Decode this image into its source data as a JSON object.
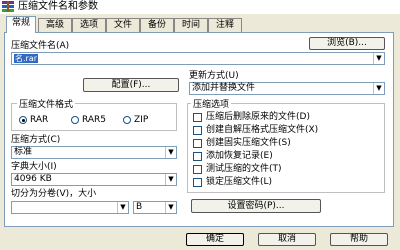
{
  "window": {
    "title": "压缩文件名和参数",
    "icon": "archive-icon"
  },
  "tabs": [
    "常规",
    "高级",
    "选项",
    "文件",
    "备份",
    "时间",
    "注释"
  ],
  "general": {
    "archive_name_label": "压缩文件名(A)",
    "archive_name_value": "名.rar",
    "browse_button": "浏览(B)...",
    "profiles_button": "配置(F)...",
    "update_mode_label": "更新方式(U)",
    "update_mode_value": "添加并替换文件",
    "format_label": "压缩文件格式",
    "formats": [
      "RAR",
      "RAR5",
      "ZIP"
    ],
    "selected_format": "RAR",
    "method_label": "压缩方式(C)",
    "method_value": "标准",
    "dictionary_label": "字典大小(I)",
    "dictionary_value": "4096 KB",
    "split_label": "切分为分卷(V)，大小",
    "split_value": "",
    "split_unit": "B",
    "options_label": "压缩选项",
    "options": [
      "压缩后删除原来的文件(D)",
      "创建自解压格式压缩文件(X)",
      "创建固实压缩文件(S)",
      "添加恢复记录(E)",
      "测试压缩的文件(T)",
      "锁定压缩文件(L)"
    ],
    "password_button": "设置密码(P)..."
  },
  "footer": {
    "ok": "确定",
    "cancel": "取消",
    "help": "帮助"
  }
}
